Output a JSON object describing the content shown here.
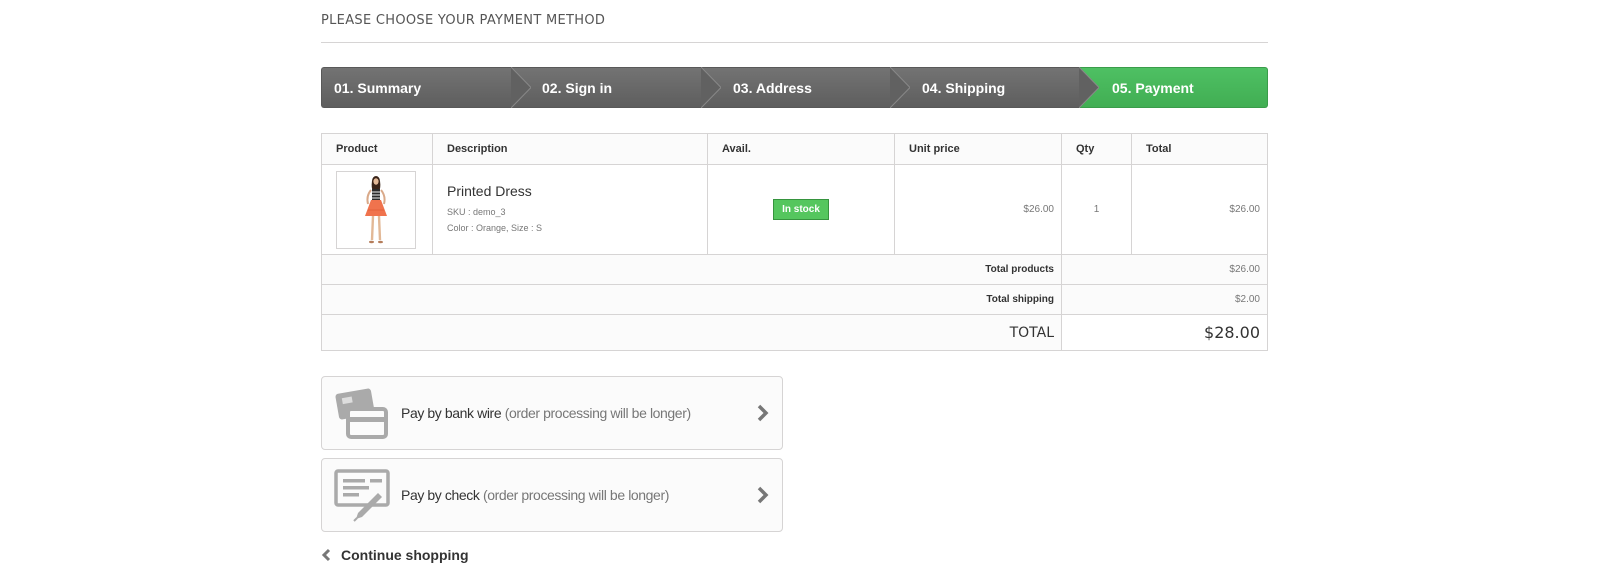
{
  "heading": "PLEASE CHOOSE YOUR PAYMENT METHOD",
  "steps": [
    {
      "label": "01. Summary",
      "active": false
    },
    {
      "label": "02. Sign in",
      "active": false
    },
    {
      "label": "03. Address",
      "active": false
    },
    {
      "label": "04. Shipping",
      "active": false
    },
    {
      "label": "05. Payment",
      "active": true
    }
  ],
  "table": {
    "headers": [
      "Product",
      "Description",
      "Avail.",
      "Unit price",
      "Qty",
      "Total"
    ],
    "items": [
      {
        "name": "Printed Dress",
        "sku": "SKU : demo_3",
        "attributes": "Color : Orange, Size : S",
        "availability": "In stock",
        "unit_price": "$26.00",
        "qty": "1",
        "total": "$26.00"
      }
    ],
    "totals": {
      "products_label": "Total products",
      "products_value": "$26.00",
      "shipping_label": "Total shipping",
      "shipping_value": "$2.00",
      "grand_label": "TOTAL",
      "grand_value": "$28.00"
    }
  },
  "payment_options": [
    {
      "icon": "bank-wire-icon",
      "title": "Pay by bank wire",
      "note": "(order processing will be longer)"
    },
    {
      "icon": "check-icon",
      "title": "Pay by check",
      "note": "(order processing will be longer)"
    }
  ],
  "continue_label": "Continue shopping",
  "colors": {
    "step_active": "#46b757",
    "step_inactive": "#686868",
    "in_stock": "#55c65e"
  }
}
